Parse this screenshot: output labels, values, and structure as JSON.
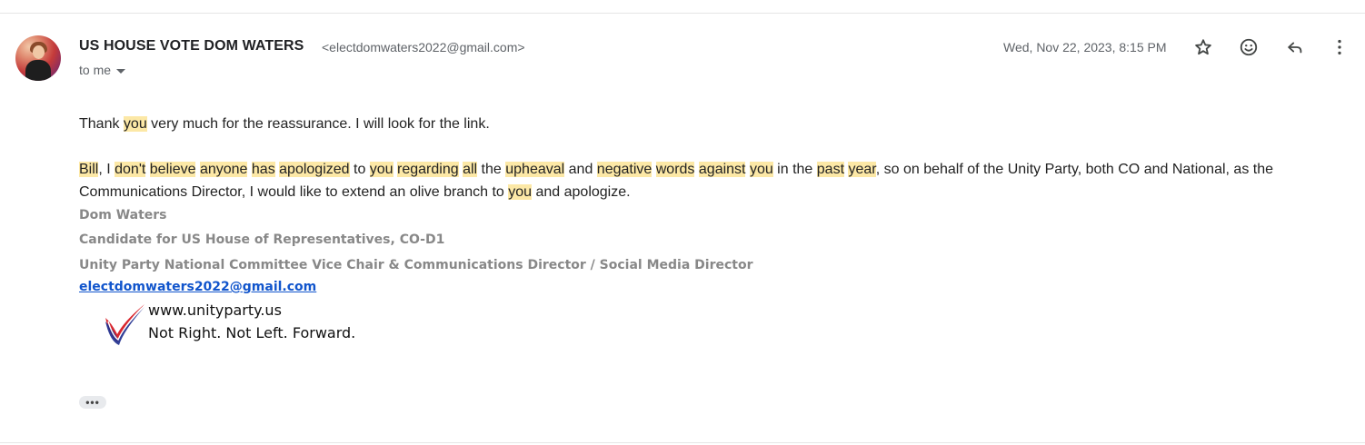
{
  "email": {
    "sender_name": "US HOUSE VOTE DOM WATERS",
    "sender_email": "<electdomwaters2022@gmail.com>",
    "to": "to me",
    "date": "Wed, Nov 22, 2023, 8:15 PM"
  },
  "icons": {
    "star": "star-icon",
    "emoji": "emoji-reaction-icon",
    "reply": "reply-icon",
    "more": "more-vert-icon",
    "ellipsis": "show-trimmed-content-icon"
  },
  "body": {
    "p1": [
      "Thank ",
      "you",
      " very much for the reassurance. I will look for the link."
    ],
    "p2": [
      "Bill",
      ", I ",
      "don't",
      " ",
      "believe",
      " ",
      "anyone",
      " ",
      "has",
      " ",
      "apologized",
      " to ",
      "you",
      " ",
      "regarding",
      " ",
      "all",
      " the ",
      "upheaval",
      " and ",
      "negative",
      " ",
      "words",
      " ",
      "against",
      " ",
      "you",
      " in the ",
      "past",
      " ",
      "year",
      ", so on behalf of the Unity Party, both CO and National, as the Communications Director, I would like to extend an olive branch to ",
      "you",
      " and apologize."
    ]
  },
  "signature": {
    "name": "Dom Waters",
    "title1": "Candidate for US House of Representatives, CO-D1",
    "title2": "Unity Party National Committee Vice Chair & Communications Director / Social Media Director",
    "email_link": "electdomwaters2022@gmail.com",
    "logo_url": "www.unityparty.us",
    "logo_tagline": "Not Right. Not Left. Forward."
  },
  "ellipsis_label": "•••",
  "colors": {
    "highlight": "#fce8a6",
    "link": "#1155cc",
    "signature_gray": "#888888",
    "logo_red": "#d8262e",
    "logo_blue": "#1c2a8c"
  }
}
